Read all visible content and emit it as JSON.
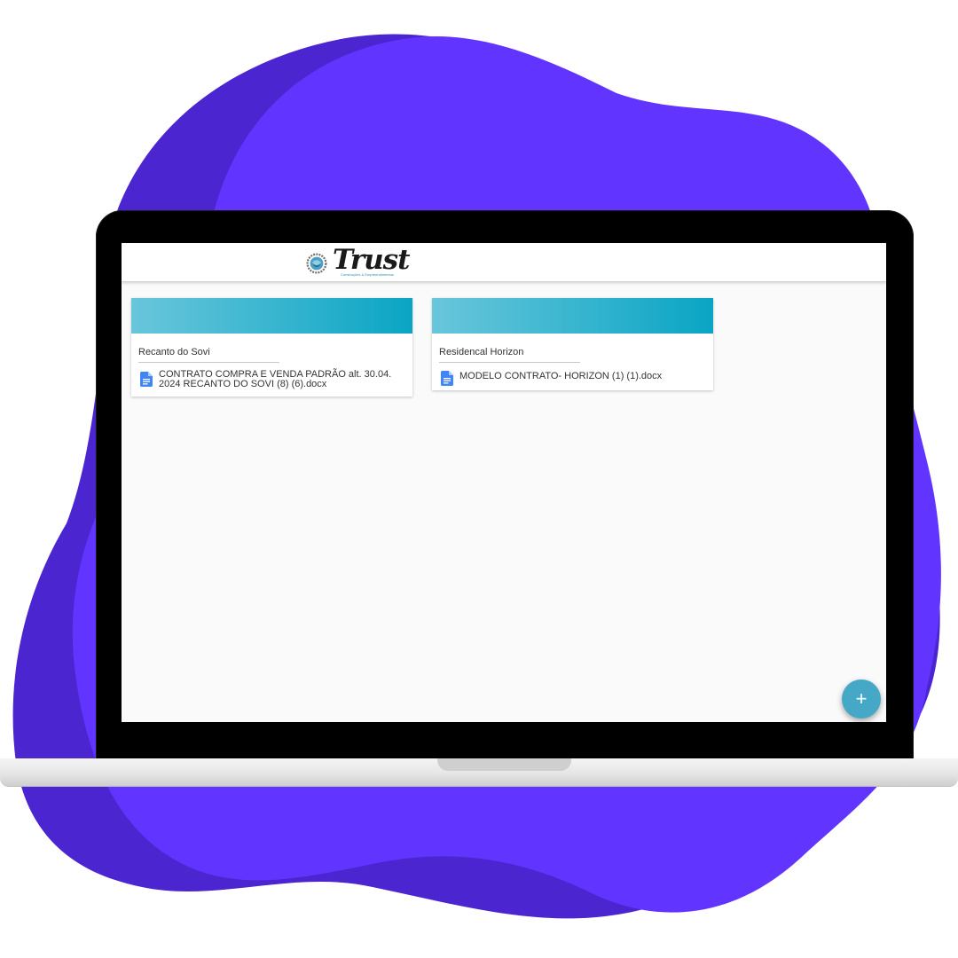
{
  "colors": {
    "background_blob": "#6234ff",
    "background_blob_shadow": "#4b25cf",
    "screen_background": "#fafafa",
    "card_banner_start": "#69c6db",
    "card_banner_end": "#0aa5c4",
    "fab": "#46a8c7",
    "file_icon": "#4285f4"
  },
  "header": {
    "logo_text": "Trust",
    "logo_tagline": "Construções & Empreendimentos",
    "logo_icon": "trust-logo-icon"
  },
  "cards": [
    {
      "title": "Recanto do Sovi",
      "files": [
        {
          "name": "CONTRATO COMPRA E VENDA PADRÃO alt. 30.04. 2024 RECANTO DO SOVI (8) (6).docx",
          "icon": "document-icon"
        }
      ]
    },
    {
      "title": "Residencal Horizon",
      "files": [
        {
          "name": "MODELO CONTRATO- HORIZON (1) (1).docx",
          "icon": "document-icon"
        }
      ]
    }
  ],
  "fab": {
    "label": "+",
    "icon": "plus-icon"
  }
}
